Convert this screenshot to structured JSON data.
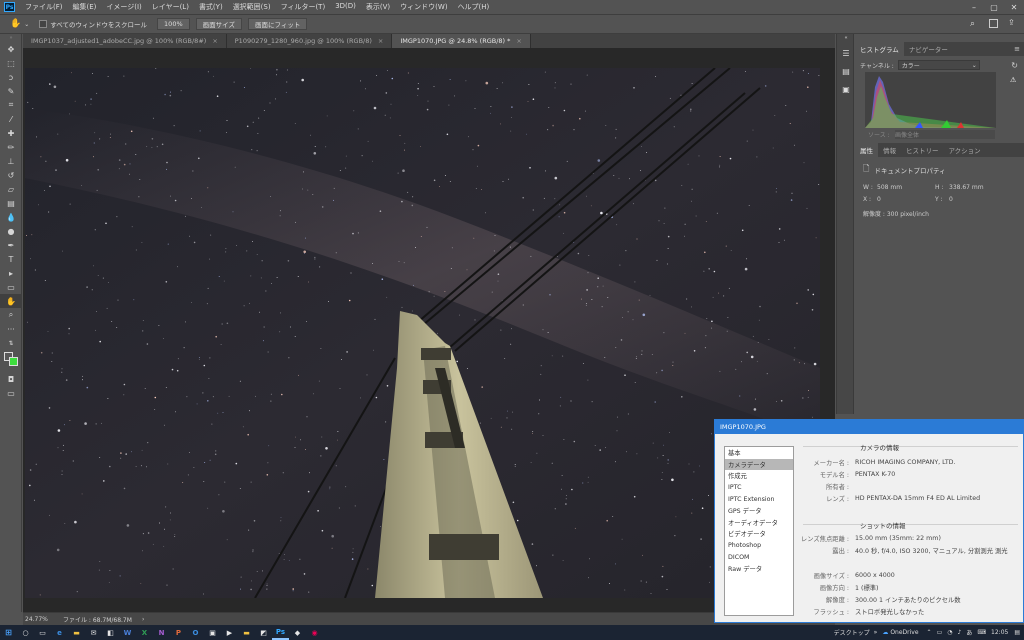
{
  "app": {
    "logo": "Ps"
  },
  "menu": [
    "ファイル(F)",
    "編集(E)",
    "イメージ(I)",
    "レイヤー(L)",
    "書式(Y)",
    "選択範囲(S)",
    "フィルター(T)",
    "3D(D)",
    "表示(V)",
    "ウィンドウ(W)",
    "ヘルプ(H)"
  ],
  "options": {
    "scroll_all_label": "すべてのウィンドウをスクロール",
    "zoom_100": "100%",
    "fit_screen": "画面サイズ",
    "fill_screen": "画面にフィット"
  },
  "tabs": [
    {
      "label": "IMGP1037_adjusted1_adobeCC.jpg @ 100% (RGB/8#)",
      "close": "×"
    },
    {
      "label": "P1090279_1280_960.jpg @ 100% (RGB/8)",
      "close": "×"
    },
    {
      "label": "IMGP1070.JPG @ 24.8% (RGB/8) *",
      "close": "×"
    }
  ],
  "status": {
    "zoom": "24.77%",
    "file": "ファイル : 68.7M/68.7M",
    "arrow": "›"
  },
  "histogram": {
    "tabs": [
      "ヒストグラム",
      "ナビゲーター"
    ],
    "channel_label": "チャンネル :",
    "channel_value": "カラー",
    "source_label": "ソース :",
    "source_value": "画像全体"
  },
  "properties": {
    "tabs": [
      "属性",
      "情報",
      "ヒストリー",
      "アクション"
    ],
    "doc_label": "ドキュメントプロパティ",
    "w_label": "W :",
    "w_value": "508 mm",
    "h_label": "H :",
    "h_value": "338.67 mm",
    "x_label": "X :",
    "x_value": "0",
    "y_label": "Y :",
    "y_value": "0",
    "resolution": "解像度 : 300 pixel/inch"
  },
  "metadata": {
    "title": "IMGP1070.JPG",
    "categories": [
      "基本",
      "カメラデータ",
      "作成元",
      "IPTC",
      "IPTC Extension",
      "GPS データ",
      "オーディオデータ",
      "ビデオデータ",
      "Photoshop",
      "DICOM",
      "Raw データ"
    ],
    "selected_index": 1,
    "camera_heading": "カメラの情報",
    "camera_rows": [
      {
        "k": "メーカー名 :",
        "v": "RICOH IMAGING COMPANY, LTD."
      },
      {
        "k": "モデル名 :",
        "v": "PENTAX K-70"
      },
      {
        "k": "所有者 :",
        "v": ""
      },
      {
        "k": "レンズ :",
        "v": "HD PENTAX-DA 15mm F4 ED AL Limited"
      }
    ],
    "shot_heading": "ショットの情報",
    "shot_rows": [
      {
        "k": "レンズ焦点距離 :",
        "v": "15.00 mm  (35mm: 22 mm)"
      },
      {
        "k": "露出 :",
        "v": "40.0 秒, f/4.0, ISO 3200, マニュアル, 分割測光 測光"
      }
    ],
    "image_rows": [
      {
        "k": "画像サイズ :",
        "v": "6000 x 4000"
      },
      {
        "k": "画像方向 :",
        "v": "1 (標準)"
      },
      {
        "k": "解像度 :",
        "v": "300.00 1 インチあたりのピクセル数"
      },
      {
        "k": "フラッシュ :",
        "v": "ストロボ発光しなかった"
      }
    ]
  },
  "taskbar": {
    "desktop": "デスクトップ",
    "onedrive": "OneDrive",
    "time": "12:05",
    "ime": "あ"
  }
}
